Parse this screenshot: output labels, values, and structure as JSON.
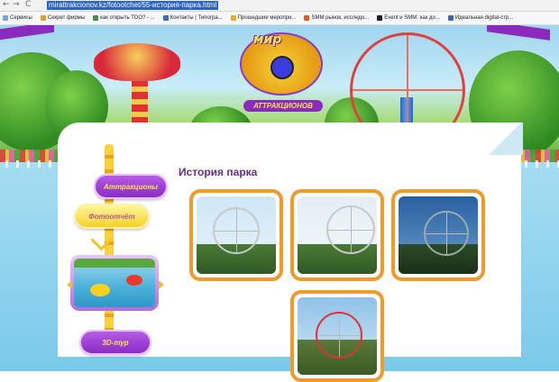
{
  "browser": {
    "url": "mirattrakcionov.kz/fotootchet/55-история-парка.html",
    "nav": {
      "back": "←",
      "forward": "→",
      "reload": "C"
    },
    "bookmarks": [
      {
        "label": "Сервисы",
        "color": "#7aa3e0"
      },
      {
        "label": "Секрет фирмы",
        "color": "#e0a020"
      },
      {
        "label": "как открыть ТОО? - ...",
        "color": "#4a8a4a"
      },
      {
        "label": "Контакты | Типогра...",
        "color": "#3a6ec0"
      },
      {
        "label": "Прошедшие меропри...",
        "color": "#e0b030"
      },
      {
        "label": "SMM рынок, исследо...",
        "color": "#e06020"
      },
      {
        "label": "Event и SMM: как до...",
        "color": "#222222"
      },
      {
        "label": "Идеальная digital-стр...",
        "color": "#4060c0"
      }
    ]
  },
  "logo": {
    "top": "мир",
    "bottom": "АТТРАКЦИОНОВ"
  },
  "nav": {
    "attractions": "Аттракционы",
    "photo_report": "Фотоотчёт",
    "tour_3d": "3D-тур"
  },
  "page": {
    "title": "История парка"
  },
  "gallery": {
    "items": [
      {
        "name": "photo-1"
      },
      {
        "name": "photo-2"
      },
      {
        "name": "photo-3"
      },
      {
        "name": "photo-4"
      }
    ]
  },
  "colors": {
    "purple": "#8a2cc4",
    "yellow": "#f4d32a",
    "orange_border": "#f09a2a",
    "title": "#6a2b8e"
  }
}
